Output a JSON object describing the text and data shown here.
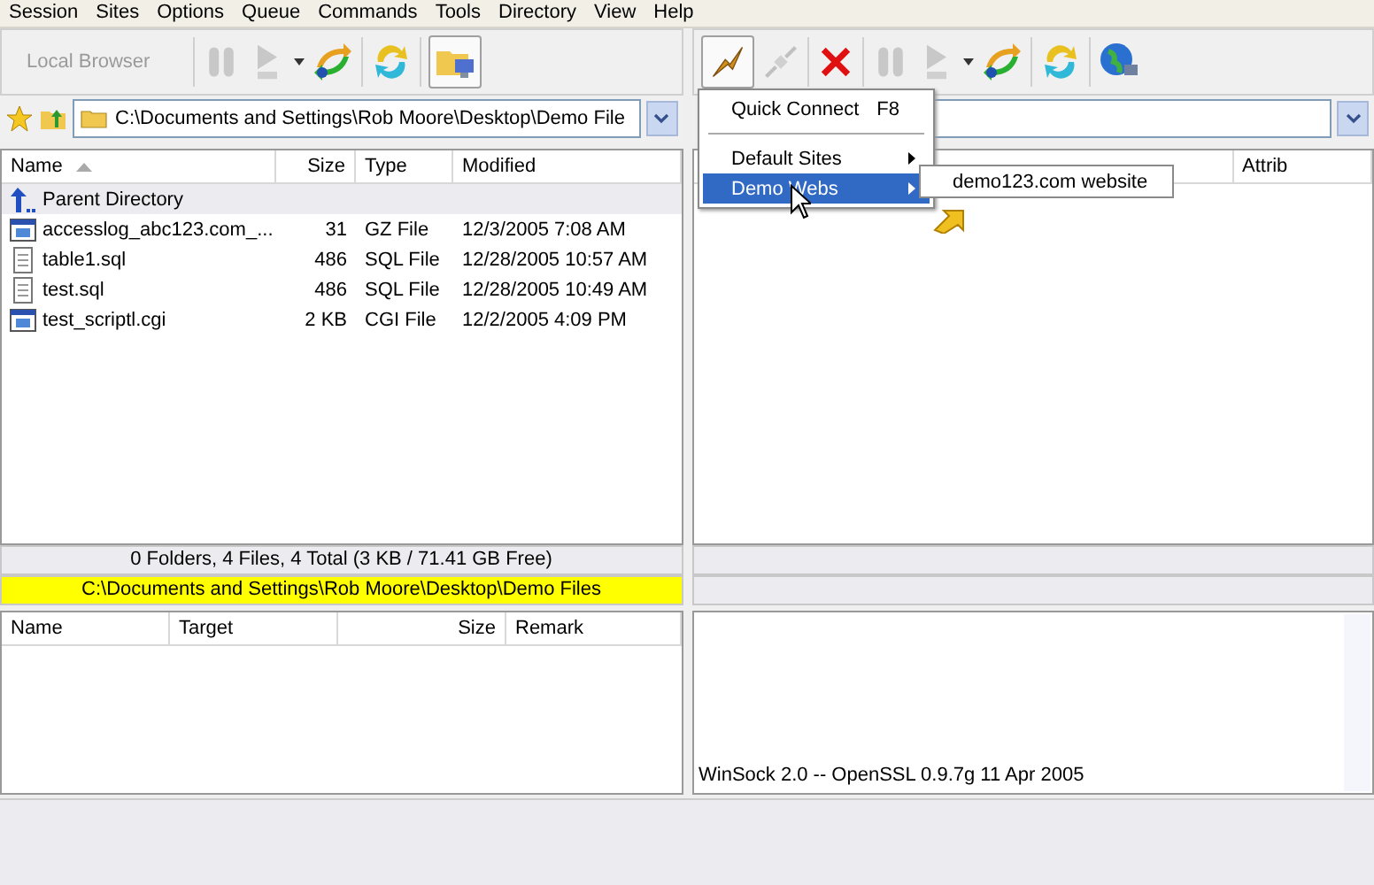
{
  "menu_bar": [
    "Session",
    "Sites",
    "Options",
    "Queue",
    "Commands",
    "Tools",
    "Directory",
    "View",
    "Help"
  ],
  "left": {
    "title": "Local Browser",
    "address": "C:\\Documents and Settings\\Rob Moore\\Desktop\\Demo File",
    "path": "C:\\Documents and Settings\\Rob Moore\\Desktop\\Demo Files",
    "columns": [
      {
        "label": "Name",
        "sorted": true
      },
      {
        "label": "Size",
        "sorted": false
      },
      {
        "label": "Type",
        "sorted": false
      },
      {
        "label": "Modified",
        "sorted": false
      }
    ],
    "rows": [
      {
        "kind": "parent",
        "name": "Parent Directory",
        "selected": true
      },
      {
        "kind": "app",
        "name": "accesslog_abc123.com_...",
        "size": "31",
        "type": "GZ File",
        "modified": "12/3/2005 7:08 AM",
        "selected": false
      },
      {
        "kind": "text",
        "name": "table1.sql",
        "size": "486",
        "type": "SQL File",
        "modified": "12/28/2005 10:57 AM",
        "selected": false
      },
      {
        "kind": "text",
        "name": "test.sql",
        "size": "486",
        "type": "SQL File",
        "modified": "12/28/2005 10:49 AM",
        "selected": false
      },
      {
        "kind": "app",
        "name": "test_scriptl.cgi",
        "size": "2 KB",
        "type": "CGI File",
        "modified": "12/2/2005 4:09 PM",
        "selected": false
      }
    ],
    "summary": "0 Folders, 4 Files, 4 Total (3 KB / 71.41 GB Free)"
  },
  "right": {
    "columns": [
      "Attrib"
    ]
  },
  "site_menu": {
    "items": [
      {
        "kind": "item",
        "label": "Quick Connect",
        "shortcut": "F8",
        "selected": false
      },
      {
        "kind": "separator"
      },
      {
        "kind": "submenu",
        "label": "Default Sites",
        "selected": false
      },
      {
        "kind": "submenu",
        "label": "Demo Webs",
        "selected": true
      }
    ],
    "submenu": [
      "demo123.com website"
    ]
  },
  "queue": {
    "columns": [
      "Name",
      "Target",
      "Size",
      "Remark"
    ]
  },
  "log": [
    "WinSock 2.0 -- OpenSSL 0.9.7g 11 Apr 2005"
  ]
}
